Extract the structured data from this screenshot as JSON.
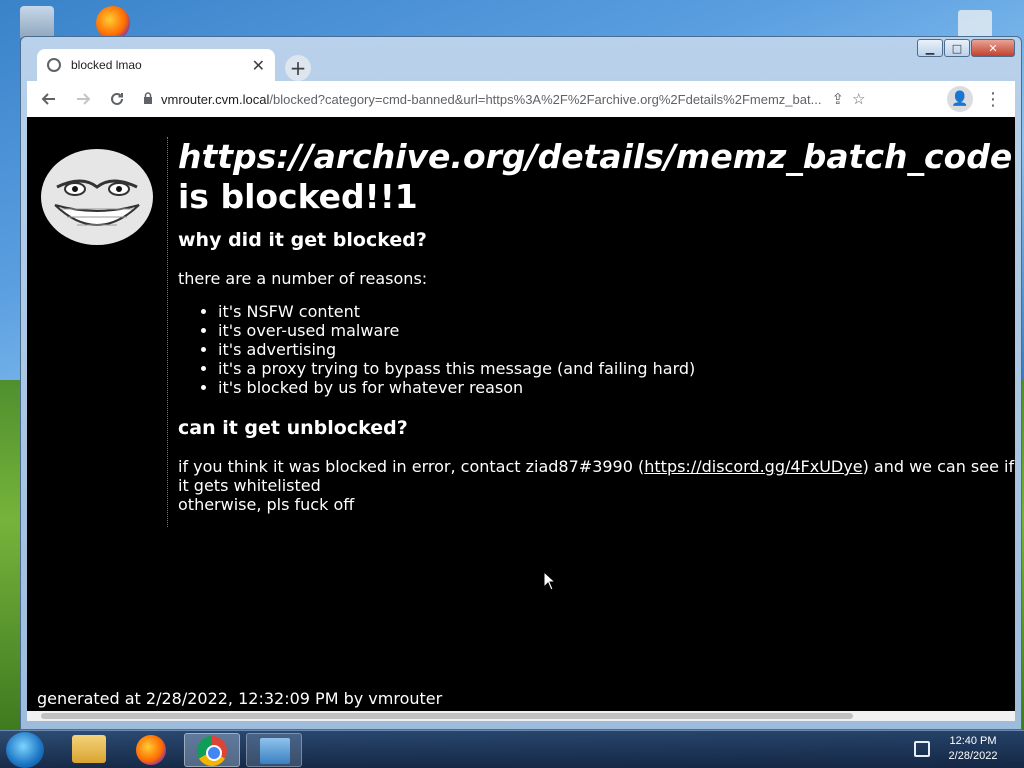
{
  "browser": {
    "tab_title": "blocked lmao",
    "new_tab_symbol": "+",
    "tab_close_symbol": "✕",
    "url_host": "vmrouter.cvm.local",
    "url_rest": "/blocked?category=cmd-banned&url=https%3A%2F%2Farchive.org%2Fdetails%2Fmemz_bat..."
  },
  "page": {
    "blocked_url": "https://archive.org/details/memz_batch_code",
    "blocked_suffix": "is blocked!!1",
    "why_heading": "why did it get blocked?",
    "reasons_intro": "there are a number of reasons:",
    "reasons": [
      "it's NSFW content",
      "it's over-used malware",
      "it's advertising",
      "it's a proxy trying to bypass this message (and failing hard)",
      "it's blocked by us for whatever reason"
    ],
    "unblock_heading": "can it get unblocked?",
    "contact_prefix": "if you think it was blocked in error, contact ziad87#3990 (",
    "contact_link": "https://discord.gg/4FxUDye",
    "contact_suffix": ") and we can see if it gets whitelisted",
    "otherwise": "otherwise, pls fuck off",
    "footer": "generated at 2/28/2022, 12:32:09 PM by vmrouter"
  },
  "taskbar": {
    "time": "12:40 PM",
    "date": "2/28/2022"
  },
  "icons": [
    "recycle-bin-icon",
    "firefox-icon",
    "globe-icon",
    "back-arrow-icon",
    "forward-arrow-icon",
    "reload-icon",
    "lock-icon",
    "share-icon",
    "star-icon",
    "profile-icon",
    "menu-icon",
    "troll-face-icon",
    "windows-start-icon",
    "explorer-icon",
    "chrome-icon",
    "control-panel-icon",
    "network-icon"
  ]
}
